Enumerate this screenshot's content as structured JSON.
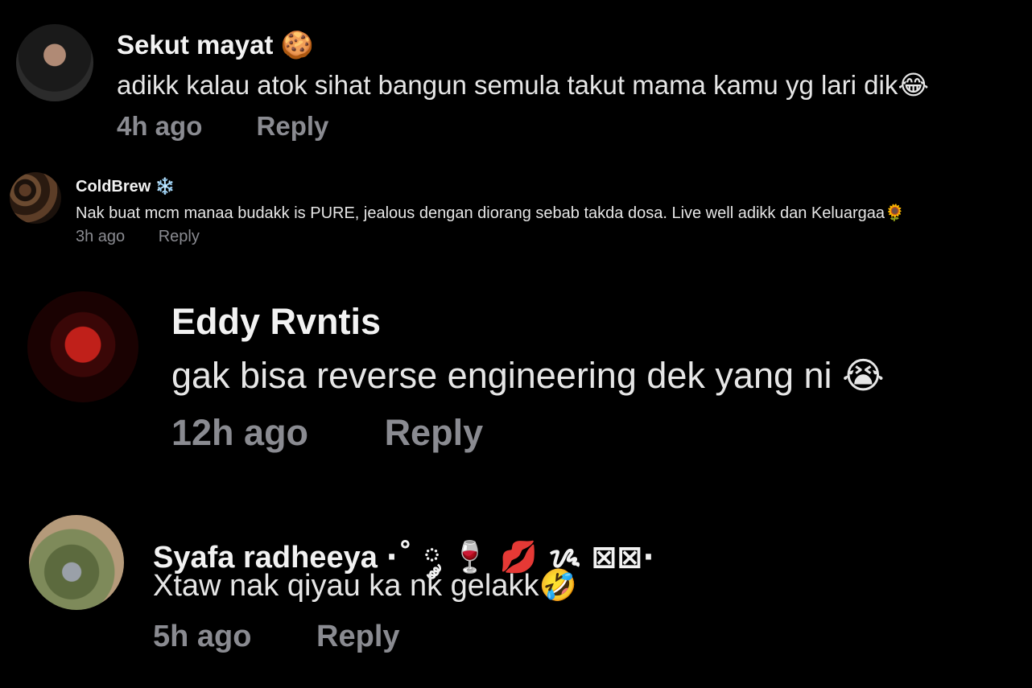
{
  "comments": [
    {
      "name": "Sekut mayat",
      "name_emoji": "🍪",
      "text": "adikk kalau atok sihat bangun semula takut mama kamu yg lari dik😂",
      "time": "4h ago",
      "reply": "Reply"
    },
    {
      "name": "ColdBrew",
      "name_emoji": "❄️",
      "text": "Nak buat mcm manaa budakk is PURE, jealous dengan diorang sebab takda dosa. Live well adikk dan Keluargaa🌻",
      "time": "3h ago",
      "reply": "Reply"
    },
    {
      "name": "Eddy Rvntis",
      "name_emoji": "",
      "text": "gak bisa reverse engineering dek yang ni 😭",
      "time": "12h ago",
      "reply": "Reply"
    },
    {
      "name": "Syafa radheeya",
      "name_emoji": "·˚ ༘ 🍷 💋 ⁠ᝰ ⊠⊠·",
      "text": "Xtaw nak qiyau ka nk gelakk🤣",
      "time": "5h ago",
      "reply": "Reply"
    }
  ]
}
